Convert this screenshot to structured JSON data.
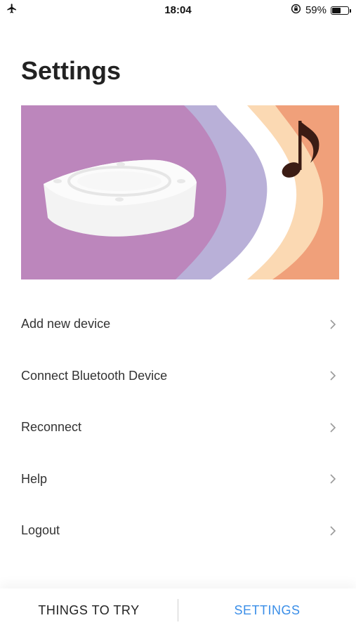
{
  "status_bar": {
    "time": "18:04",
    "battery_text": "59%",
    "battery_level": 0.59,
    "icons": [
      "airplane-mode-icon",
      "orientation-lock-icon",
      "battery-icon"
    ]
  },
  "page": {
    "title": "Settings"
  },
  "hero": {
    "description_icons": [
      "speaker-device-illustration",
      "music-note-icon"
    ],
    "colors": {
      "purple": "#bc86bc",
      "lavender": "#b9b0d8",
      "white": "#ffffff",
      "peach": "#fbd9b3",
      "orange": "#f0a07a",
      "note": "#3b1c14"
    }
  },
  "menu": {
    "items": [
      {
        "label": "Add new device"
      },
      {
        "label": "Connect Bluetooth Device"
      },
      {
        "label": "Reconnect"
      },
      {
        "label": "Help"
      },
      {
        "label": "Logout"
      }
    ]
  },
  "tab_bar": {
    "tabs": [
      {
        "label": "THINGS TO TRY",
        "active": false
      },
      {
        "label": "SETTINGS",
        "active": true
      }
    ],
    "active_color": "#3a8ee8"
  }
}
